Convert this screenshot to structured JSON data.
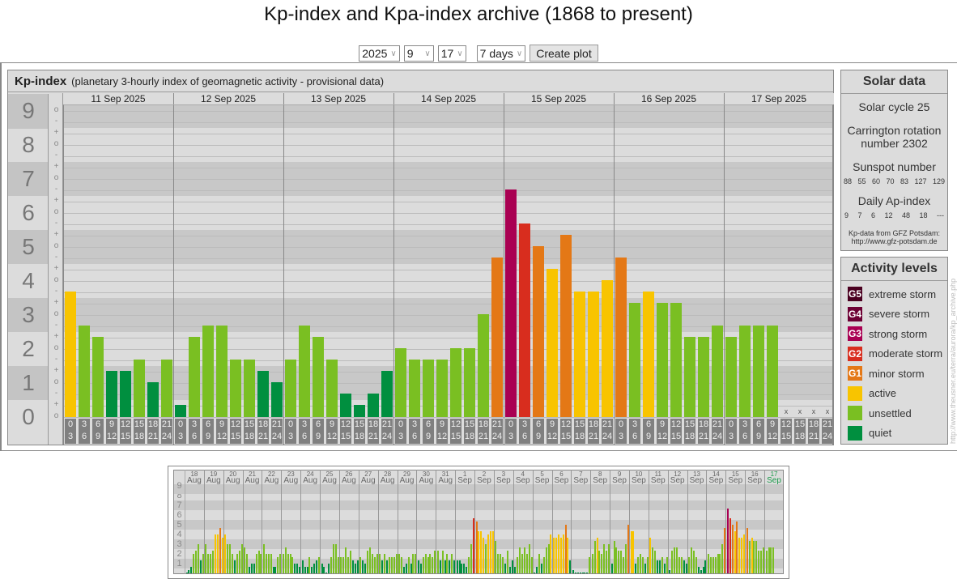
{
  "title": "Kp-index and Kpa-index archive (1868 to present)",
  "controls": {
    "year": "2025",
    "month": "9",
    "day": "17",
    "range": "7 days",
    "create_label": "Create plot"
  },
  "main": {
    "heading": "Kp-index",
    "subheading": "(planetary 3-hourly index of geomagnetic activity - provisional data)",
    "level_labels": [
      "0",
      "1",
      "2",
      "3",
      "4",
      "5",
      "6",
      "7",
      "8",
      "9"
    ],
    "slot_labels": [
      [
        "0",
        "3"
      ],
      [
        "3",
        "6"
      ],
      [
        "6",
        "9"
      ],
      [
        "9",
        "12"
      ],
      [
        "12",
        "15"
      ],
      [
        "15",
        "18"
      ],
      [
        "18",
        "21"
      ],
      [
        "21",
        "24"
      ]
    ],
    "missing_mark": "x"
  },
  "chart_data": {
    "type": "bar",
    "title": "Kp-index",
    "ylabel": "Kp",
    "ylim": [
      0,
      9
    ],
    "categories": [
      "11 Sep 2025",
      "12 Sep 2025",
      "13 Sep 2025",
      "14 Sep 2025",
      "15 Sep 2025",
      "16 Sep 2025",
      "17 Sep 2025"
    ],
    "values": [
      [
        "4-",
        "3-",
        "2+",
        "1+",
        "1+",
        "2-",
        "1o",
        "2-"
      ],
      [
        "0+",
        "2+",
        "3-",
        "3-",
        "2-",
        "2-",
        "1+",
        "1o"
      ],
      [
        "2-",
        "3-",
        "2+",
        "2-",
        "1-",
        "0+",
        "1-",
        "1+"
      ],
      [
        "2o",
        "2-",
        "2-",
        "2-",
        "2o",
        "2o",
        "3o",
        "5-"
      ],
      [
        "7-",
        "6-",
        "5o",
        "4+",
        "5+",
        "4-",
        "4-",
        "4o"
      ],
      [
        "5-",
        "3+",
        "4-",
        "3+",
        "3+",
        "2+",
        "2+",
        "3-"
      ],
      [
        "2+",
        "3-",
        "3-",
        "3-",
        null,
        null,
        null,
        null
      ]
    ],
    "overview": {
      "type": "bar",
      "ylim": [
        0,
        9
      ],
      "days": [
        [
          "18",
          "Aug"
        ],
        [
          "19",
          "Aug"
        ],
        [
          "20",
          "Aug"
        ],
        [
          "21",
          "Aug"
        ],
        [
          "22",
          "Aug"
        ],
        [
          "23",
          "Aug"
        ],
        [
          "24",
          "Aug"
        ],
        [
          "25",
          "Aug"
        ],
        [
          "26",
          "Aug"
        ],
        [
          "27",
          "Aug"
        ],
        [
          "28",
          "Aug"
        ],
        [
          "29",
          "Aug"
        ],
        [
          "30",
          "Aug"
        ],
        [
          "31",
          "Aug"
        ],
        [
          "1",
          "Sep"
        ],
        [
          "2",
          "Sep"
        ],
        [
          "3",
          "Sep"
        ],
        [
          "4",
          "Sep"
        ],
        [
          "5",
          "Sep"
        ],
        [
          "6",
          "Sep"
        ],
        [
          "7",
          "Sep"
        ],
        [
          "8",
          "Sep"
        ],
        [
          "9",
          "Sep"
        ],
        [
          "10",
          "Sep"
        ],
        [
          "11",
          "Sep"
        ],
        [
          "12",
          "Sep"
        ],
        [
          "13",
          "Sep"
        ],
        [
          "14",
          "Sep"
        ],
        [
          "15",
          "Sep"
        ],
        [
          "16",
          "Sep"
        ],
        [
          "17",
          "Sep"
        ]
      ],
      "values": [
        [
          0,
          0.33,
          0.67,
          2,
          2.33,
          3,
          1.33,
          2
        ],
        [
          3,
          2,
          2,
          2.33,
          4,
          4,
          4.67,
          3.67
        ],
        [
          4,
          3,
          3,
          2,
          1.33,
          2,
          2.33,
          3
        ],
        [
          2.67,
          2,
          0.67,
          1,
          1,
          2,
          2.33,
          2
        ],
        [
          3,
          2,
          2,
          2,
          0.67,
          0.67,
          1.67,
          2
        ],
        [
          2,
          2.67,
          2,
          2,
          1.67,
          1,
          1,
          0.67
        ],
        [
          1.33,
          0.67,
          0.67,
          1.67,
          0.67,
          1,
          1.33,
          1.67
        ],
        [
          1,
          0.67,
          0,
          1,
          1.67,
          3,
          3,
          1.67
        ],
        [
          1.67,
          1.67,
          2.67,
          1.67,
          2.33,
          1.33,
          1,
          1.33
        ],
        [
          1.67,
          1.33,
          1,
          2.33,
          2.67,
          2,
          1.67,
          2
        ],
        [
          2,
          1.33,
          2,
          1.33,
          1.67,
          1.67,
          1.67,
          2
        ],
        [
          2,
          1.67,
          0.67,
          1,
          1.67,
          1,
          2,
          2
        ],
        [
          1.33,
          1,
          1.67,
          2,
          1.67,
          2,
          1.67,
          2.33
        ],
        [
          2.33,
          1.33,
          2.33,
          1.33,
          2,
          1.33,
          2,
          1.33
        ],
        [
          1.33,
          1.33,
          1,
          1,
          0.67,
          1.67,
          3,
          5.67
        ],
        [
          5.33,
          4.33,
          4.33,
          3.67,
          3,
          4,
          4.33,
          4.33
        ],
        [
          3.33,
          2,
          2,
          1.67,
          1,
          2.33,
          0.67,
          1.33
        ],
        [
          0.67,
          1.67,
          2.67,
          2,
          2.67,
          2,
          3,
          1.67
        ],
        [
          0,
          0.67,
          2,
          1,
          1.67,
          2.67,
          3,
          4
        ],
        [
          3.67,
          3.67,
          4,
          3.67,
          4,
          5,
          3.67,
          1.33
        ],
        [
          0.33,
          0,
          0,
          0,
          0,
          0,
          0,
          1.67
        ],
        [
          2,
          3.33,
          3.67,
          2.33,
          2,
          3,
          2.33,
          3
        ],
        [
          1,
          3.33,
          2.67,
          2.33,
          2.33,
          1.67,
          3,
          5
        ],
        [
          4.33,
          4.33,
          1,
          1.67,
          2,
          1.67,
          1,
          1.67
        ],
        [
          3.67,
          2.67,
          2.33,
          1.33,
          1.33,
          1.67,
          1,
          1.67
        ],
        [
          0.33,
          2.33,
          2.67,
          2.67,
          1.67,
          1.67,
          1.33,
          1
        ],
        [
          1.67,
          2.67,
          2.33,
          1.67,
          0.67,
          0.33,
          0.67,
          1.33
        ],
        [
          2,
          1.67,
          1.67,
          1.67,
          2,
          2,
          3,
          4.67
        ],
        [
          6.67,
          5.67,
          5,
          4.33,
          5.33,
          3.67,
          3.67,
          4
        ],
        [
          4.67,
          3.33,
          3.67,
          3.33,
          3.33,
          2.33,
          2.33,
          2.67
        ],
        [
          2.33,
          2.67,
          2.67,
          2.67
        ]
      ]
    }
  },
  "solar": {
    "heading": "Solar data",
    "cycle": "Solar cycle 25",
    "carrington_1": "Carrington rotation",
    "carrington_2": "number 2302",
    "sunspot_label": "Sunspot number",
    "sunspot_values": "88 55 60 70 83 127 129",
    "ap_label": "Daily Ap-index",
    "ap_values": "9 7 6 12 48 18 ---",
    "source_1": "Kp-data from GFZ Potsdam:",
    "source_2": "http://www.gfz-potsdam.de"
  },
  "activity": {
    "heading": "Activity levels",
    "levels": [
      {
        "badge": "G5",
        "label": "extreme storm",
        "color": "#4a0020"
      },
      {
        "badge": "G4",
        "label": "severe storm",
        "color": "#6d0034"
      },
      {
        "badge": "G3",
        "label": "strong storm",
        "color": "#a90052"
      },
      {
        "badge": "G2",
        "label": "moderate storm",
        "color": "#d82d1e"
      },
      {
        "badge": "G1",
        "label": "minor storm",
        "color": "#e47816"
      },
      {
        "badge": "",
        "label": "active",
        "color": "#f8c400"
      },
      {
        "badge": "",
        "label": "unsettled",
        "color": "#7abf22"
      },
      {
        "badge": "",
        "label": "quiet",
        "color": "#008f3f"
      }
    ]
  },
  "watermark": "http://www.theusner.eu/terra/aurora/kp_archive.php"
}
